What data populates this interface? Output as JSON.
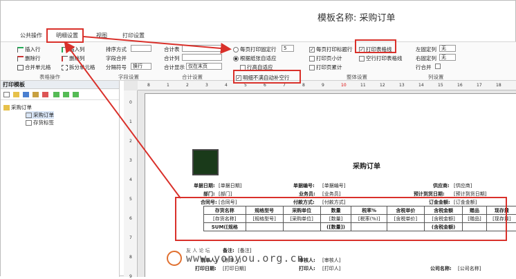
{
  "title": "模板名称: 采购订单",
  "tabs": [
    {
      "label": "公共操作"
    },
    {
      "label": "明细设置"
    },
    {
      "label": "视图"
    },
    {
      "label": "打印设置"
    }
  ],
  "ribbon": {
    "table_ops": {
      "items": [
        "插入行",
        "删除行",
        "合并单元格",
        "插入列",
        "删除列",
        "拆分单元格"
      ],
      "group_label": "表格操作"
    },
    "field_settings": {
      "sort_label": "排序方式",
      "field_merge_label": "字段合并",
      "group_sep_label": "分隔符号",
      "group_sep_value": "换行",
      "group_label": "字段设置"
    },
    "total_settings": {
      "total_table_label": "合计表",
      "total_col_label": "合计列",
      "total_show_label": "合计显示",
      "total_show_value": "仅在末页",
      "group_label": "合计设置"
    },
    "print_rows": {
      "fixed_rows_label": "每页打印固定行",
      "fixed_rows_value": "5",
      "adapt_label": "根据纸张自适应",
      "row_height_label": "行高自适应",
      "fill_blank_label": "明细不满自动补空行"
    },
    "page_settings": {
      "title_row_label": "每页打印标题行",
      "subtotal_label": "打印页小计",
      "cumulative_label": "打印页累计",
      "print_grid_label": "打印表格线",
      "blank_grid_label": "空行打印表格线",
      "group_label": "整体设置"
    },
    "col_settings": {
      "left_fixed_label": "左固定列",
      "left_fixed_value": "无",
      "right_fixed_label": "右固定列",
      "right_fixed_value": "无",
      "merge_label": "行合并",
      "group_label": "列设置"
    }
  },
  "left_panel": {
    "header": "打印模板",
    "tree": [
      {
        "label": "采购订单"
      },
      {
        "label": "采购订单"
      },
      {
        "label": "存货标签"
      }
    ]
  },
  "ruler": {
    "h": [
      "8",
      "1",
      "2",
      "3",
      "4",
      "5",
      "6",
      "7",
      "8",
      "9",
      "10",
      "11",
      "12",
      "13",
      "14",
      "15",
      "16",
      "17",
      "18"
    ],
    "v": [
      "0",
      "1",
      "2",
      "3",
      "4",
      "5",
      "6",
      "7",
      "8",
      "9"
    ]
  },
  "doc": {
    "title": "采购订单",
    "fields": [
      {
        "label": "单据日期:",
        "value": "[单据日期]"
      },
      {
        "label": "单据编号:",
        "value": "[单据编号]"
      },
      {
        "label": "供应商:",
        "value": "[供应商]"
      },
      {
        "label": "部门:",
        "value": "[部门]"
      },
      {
        "label": "业务员:",
        "value": "[业务员]"
      },
      {
        "label": "预计到货日期:",
        "value": "[预计到货日期]"
      },
      {
        "label": "合同号:",
        "value": "[合同号]"
      },
      {
        "label": "付款方式:",
        "value": "[付款方式]"
      },
      {
        "label": "订金金额:",
        "value": "[订金金额]"
      }
    ],
    "table_headers": [
      "存货名称",
      "规格型号",
      "采购单位",
      "数量",
      "税率%",
      "含税单价",
      "含税金额",
      "赠品",
      "现存量"
    ],
    "table_row": [
      "[存货名称]",
      "[规格型号]",
      "[采购单位]",
      "[数量]",
      "[税率(%)]",
      "[含税单价]",
      "[含税金额]",
      "[赠品]",
      "[现存量]"
    ],
    "sum_row": [
      "SUM([规格",
      "",
      "",
      "([数量])",
      "",
      "",
      "(含税金额)",
      "",
      ""
    ],
    "footer": [
      {
        "label": "备注:",
        "value": "[备注]"
      },
      {
        "label": "制单人:",
        "value": "[制单人]"
      },
      {
        "label": "审核人:",
        "value": "[审核人]"
      },
      {
        "label": "打印日期:",
        "value": "[打印日期]"
      },
      {
        "label": "打印人:",
        "value": "[打印人]"
      },
      {
        "label": "公司名称:",
        "value": "[公司名称]"
      }
    ]
  },
  "watermark": {
    "url": "www.yonyou.org.cn",
    "sub": "友 人 论 坛"
  },
  "colors": {
    "highlight": "#d9302a",
    "accent_red": "#dd0000"
  }
}
